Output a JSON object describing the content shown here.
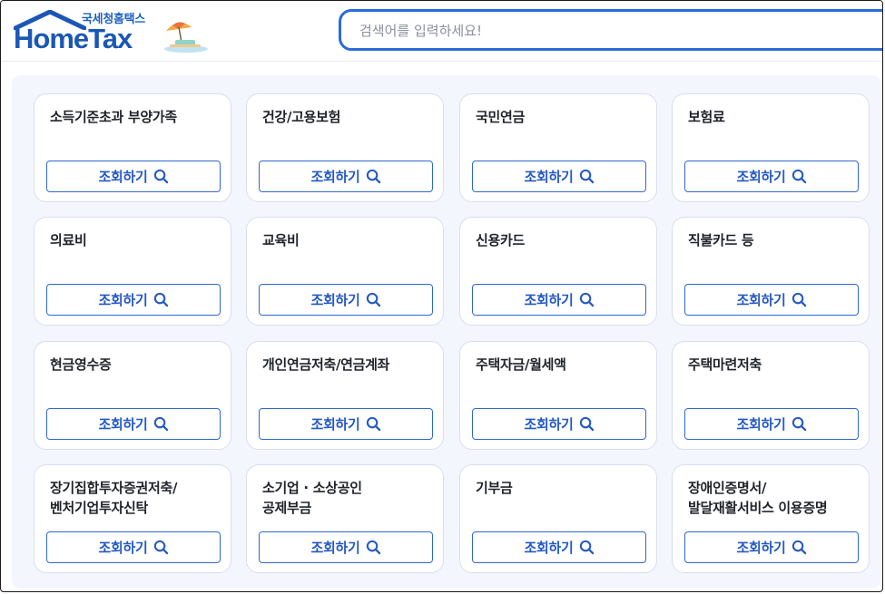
{
  "header": {
    "logo_sub": "국세청홈택스",
    "logo_main": "HomeTax",
    "search_placeholder": "검색어를 입력하세요!"
  },
  "cards": [
    {
      "title": "소득기준초과 부양가족",
      "button": "조회하기"
    },
    {
      "title": "건강/고용보험",
      "button": "조회하기"
    },
    {
      "title": "국민연금",
      "button": "조회하기"
    },
    {
      "title": "보험료",
      "button": "조회하기"
    },
    {
      "title": "의료비",
      "button": "조회하기"
    },
    {
      "title": "교육비",
      "button": "조회하기"
    },
    {
      "title": "신용카드",
      "button": "조회하기"
    },
    {
      "title": "직불카드 등",
      "button": "조회하기"
    },
    {
      "title": "현금영수증",
      "button": "조회하기"
    },
    {
      "title": "개인연금저축/연금계좌",
      "button": "조회하기"
    },
    {
      "title": "주택자금/월세액",
      "button": "조회하기"
    },
    {
      "title": "주택마련저축",
      "button": "조회하기"
    },
    {
      "title": "장기집합투자증권저축/\n벤처기업투자신탁",
      "button": "조회하기"
    },
    {
      "title": "소기업 · 소상공인\n공제부금",
      "button": "조회하기"
    },
    {
      "title": "기부금",
      "button": "조회하기"
    },
    {
      "title": "장애인증명서/\n발달재활서비스 이용증명",
      "button": "조회하기"
    }
  ],
  "colors": {
    "brand": "#1b57b5",
    "accent": "#2b6ad8",
    "panel_bg": "#f3f6fc"
  },
  "icons": {
    "button_icon": "search-icon"
  }
}
